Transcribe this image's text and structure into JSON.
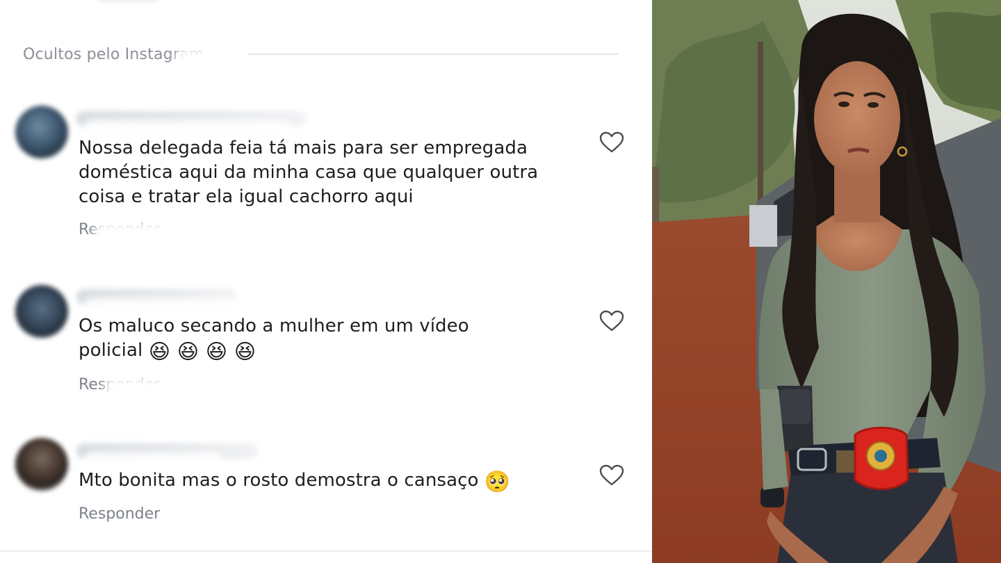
{
  "section": {
    "label": "Ocultos pelo Instagram"
  },
  "comments": [
    {
      "text": "Nossa delegada feia tá mais para ser empregada doméstica aqui da minha casa que qualquer outra coisa e tratar ela igual cachorro aqui",
      "emoji": "",
      "reply_label": "Responder"
    },
    {
      "text": "Os maluco secando a mulher em um vídeo policial",
      "emoji": "😆 😆 😆 😆",
      "reply_label": "Responder"
    },
    {
      "text": "Mto bonita mas o rosto demostra o cansaço",
      "emoji": "🥺",
      "reply_label": "Responder"
    }
  ],
  "icons": {
    "like": "heart-outline-icon"
  },
  "colors": {
    "text": "#1c1e21",
    "muted": "#8a8f98",
    "divider": "#e3e5e8",
    "badge": "#d9251d",
    "top": "#7a8a76",
    "ground": "#a5452a"
  }
}
